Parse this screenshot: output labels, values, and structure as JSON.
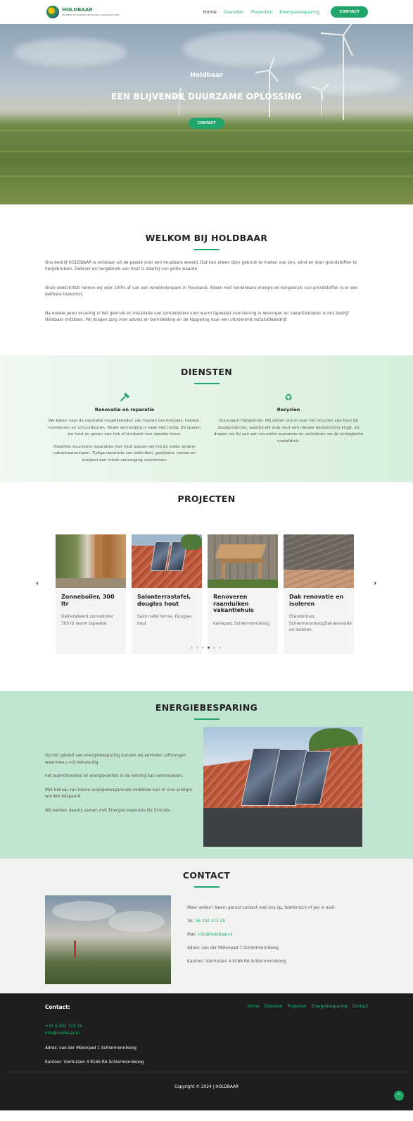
{
  "header": {
    "logo_name": "HOLDBAAR",
    "logo_tagline": "Houdbare en blijvende oplossingen in energie en hout",
    "nav": [
      "Home",
      "Diensten",
      "Projecten",
      "Energiebesparing"
    ],
    "nav_button": "CONTACT"
  },
  "hero": {
    "subtitle": "Holdbaar",
    "title": "EEN BLIJVENDE DUURZAME OPLOSSING",
    "button": "CONTACT"
  },
  "welcome": {
    "title": "WELKOM BIJ HOLDBAAR",
    "paragraphs": [
      "Ons bedrijf HOLDBAAR is ontstaan uit de passie voor een houdbare wereld. Dat kan alleen door gebruik te maken van zon, wind en door grondstoffen te hergebruiken. Gebruik en hergebruik van hout is daarbij van grote waarde.",
      "Onze elektriciteit nemen wij voor 100% af van een windmolenpark in Flevoland. Alleen met herwinbare energie en hergebruik van grondstoffen is er een leefbare toekomst.",
      "Na enkele jaren ervaring in het gebruik en installatie van zonneboilers voor warm tapwater voorziening in woningen en vakantiehuizen is ons bedrijf Holdbaar ontstaan. Wij dragen zorg voor advies en bemiddeling en de koppeling naar een uitvoerend installatiebedrijf."
    ]
  },
  "diensten": {
    "title": "DIENSTEN",
    "items": [
      {
        "icon": "hammer-icon",
        "title": "Renovatie en reparatie",
        "paragraphs": [
          "We kijken naar de reparatie mogelijkheden van houten tuinmeubels, hekken, tuindeuren en schuurdeuren. Totale vervanging is vaak niet nodig. Zo sparen we hout en geven een hek of tuinbank een tweede leven.",
          "Dezelfde duurzame reparaties met hout passen wij toe bij onder andere vakantiewoningen. Tijdige reparatie van dakluiken, goslijsten, ramen en kozijnen kan totale vervanging voorkomen."
        ]
      },
      {
        "icon": "recycle-icon",
        "title": "Recyclen",
        "paragraphs": [
          "Duurzaam Hergebruik: Wij zetten ons in voor het recyclen van hout bij bouwprojecten, waarbij elk stuk hout een nieuwe bestemming krijgt. Zo dragen we bij aan een circulaire economie en verkleinen we de ecologische voetafdruk."
        ]
      }
    ]
  },
  "projecten": {
    "title": "PROJECTEN",
    "cards": [
      {
        "title": "Zonneboiler, 300 ltr",
        "desc": "Geïnstalleerd zonneboiler 300 ltr warm tapwater."
      },
      {
        "title": "Salonterrastafel, douglas hout",
        "desc": "Salon tafel terras, Douglas hout"
      },
      {
        "title": "Renoveren raamluiken vakantiehuis",
        "desc": "Karrepad, Schiermonnikoog"
      },
      {
        "title": "Dak renovatie en isoleren",
        "desc": "Eilanderhuis, SchiermonnikoogDakrenovatie en isoleren"
      }
    ],
    "arrow_prev": "‹",
    "arrow_next": "›",
    "dot_count": 6,
    "active_dot": 3
  },
  "energie": {
    "title": "ENERGIEBESPARING",
    "paragraphs": [
      "Op het gebied van energiebesparing kunnen wij adviezen uitbrengen waarmee u vrij eenvoudig",
      "het warmteverlies en energieverlies in de woning kan verminderen.",
      "Met behulp van kleine energiebesparende middelen kan er snel energie worden bespaard.",
      "Wij werken daarbij samen met Energiecooperatie De Sintrale."
    ]
  },
  "contact": {
    "title": "CONTACT",
    "intro": "Meer weten? Neem gerust contact met ons op, telefonisch of per e-mail:",
    "tel_label": "Tel: ",
    "tel": "06 202 313 29",
    "mail_label": "Mail: ",
    "mail": "info@holdbaar.nl",
    "adres": "Adres: van der Molenpad 1 Schiermonnikoog",
    "kantoor": "Kantoor: Vierhuizen 4  9166 RA Schiermonnikoog"
  },
  "footer": {
    "heading": "Contact:",
    "nav": [
      "Home",
      "Diensten",
      "Projecten",
      "Energiebesparing",
      "Contact"
    ],
    "phone": "+31 6 202 313 29",
    "mail": "info@holdbaar.nl",
    "adres": "Adres: van der Molenpad 1 Schiermonnikoog",
    "kantoor": "Kantoor: Vierhuizen 4  9166 RA Schiermonnikoog",
    "copyright": "Copyright © 2024 | HOLDBAAR",
    "to_top": "^"
  },
  "colors": {
    "accent": "#22a56b",
    "link": "#22b573",
    "footer_bg": "#1e1e1e",
    "energie_bg": "#c1e5d1"
  }
}
